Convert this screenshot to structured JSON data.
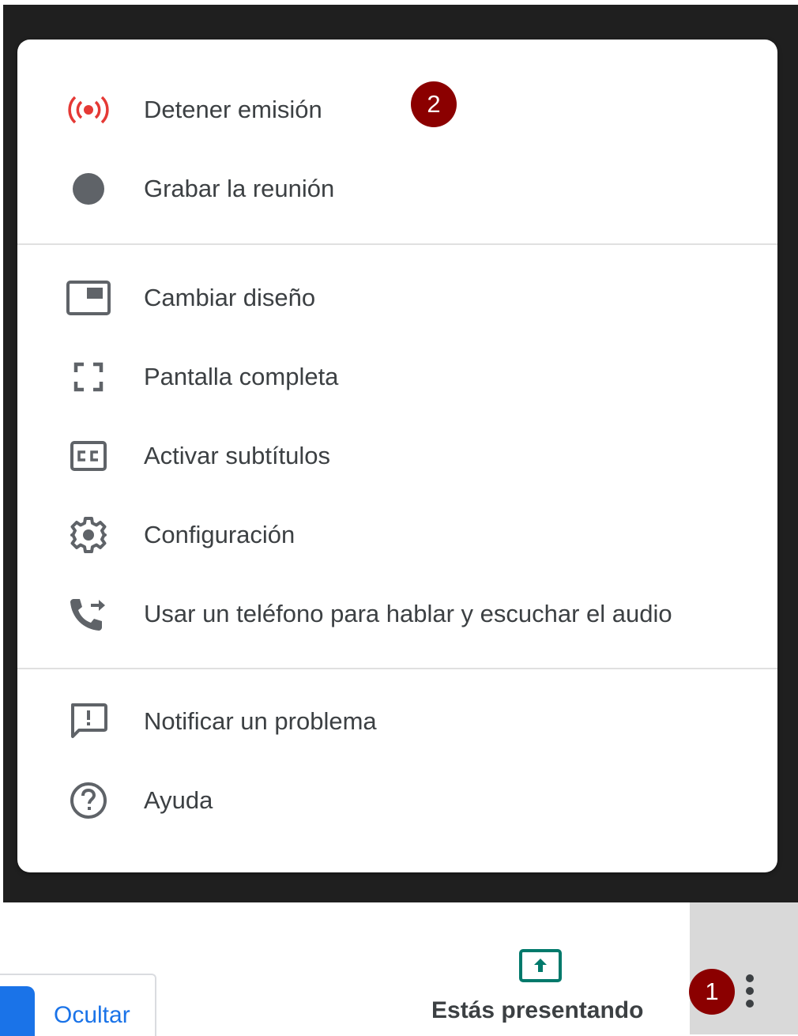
{
  "menu": {
    "items": [
      {
        "label": "Detener emisión",
        "icon": "broadcast-icon"
      },
      {
        "label": "Grabar la reunión",
        "icon": "record-dot-icon"
      },
      {
        "label": "Cambiar diseño",
        "icon": "layout-icon"
      },
      {
        "label": "Pantalla completa",
        "icon": "fullscreen-icon"
      },
      {
        "label": "Activar subtítulos",
        "icon": "closed-captions-icon"
      },
      {
        "label": "Configuración",
        "icon": "gear-icon"
      },
      {
        "label": "Usar un teléfono para hablar y escuchar el audio",
        "icon": "phone-forward-icon"
      },
      {
        "label": "Notificar un problema",
        "icon": "report-problem-icon"
      },
      {
        "label": "Ayuda",
        "icon": "help-circle-icon"
      }
    ]
  },
  "badges": {
    "menu_step": "2",
    "more_step": "1"
  },
  "bottom_bar": {
    "hide_label": "Ocultar",
    "presenting_label": "Estás presentando"
  },
  "colors": {
    "broadcast_red": "#e53935",
    "badge": "#8b0000",
    "present_teal": "#00796b",
    "link_blue": "#1a73e8",
    "icon_gray": "#5f6368"
  }
}
